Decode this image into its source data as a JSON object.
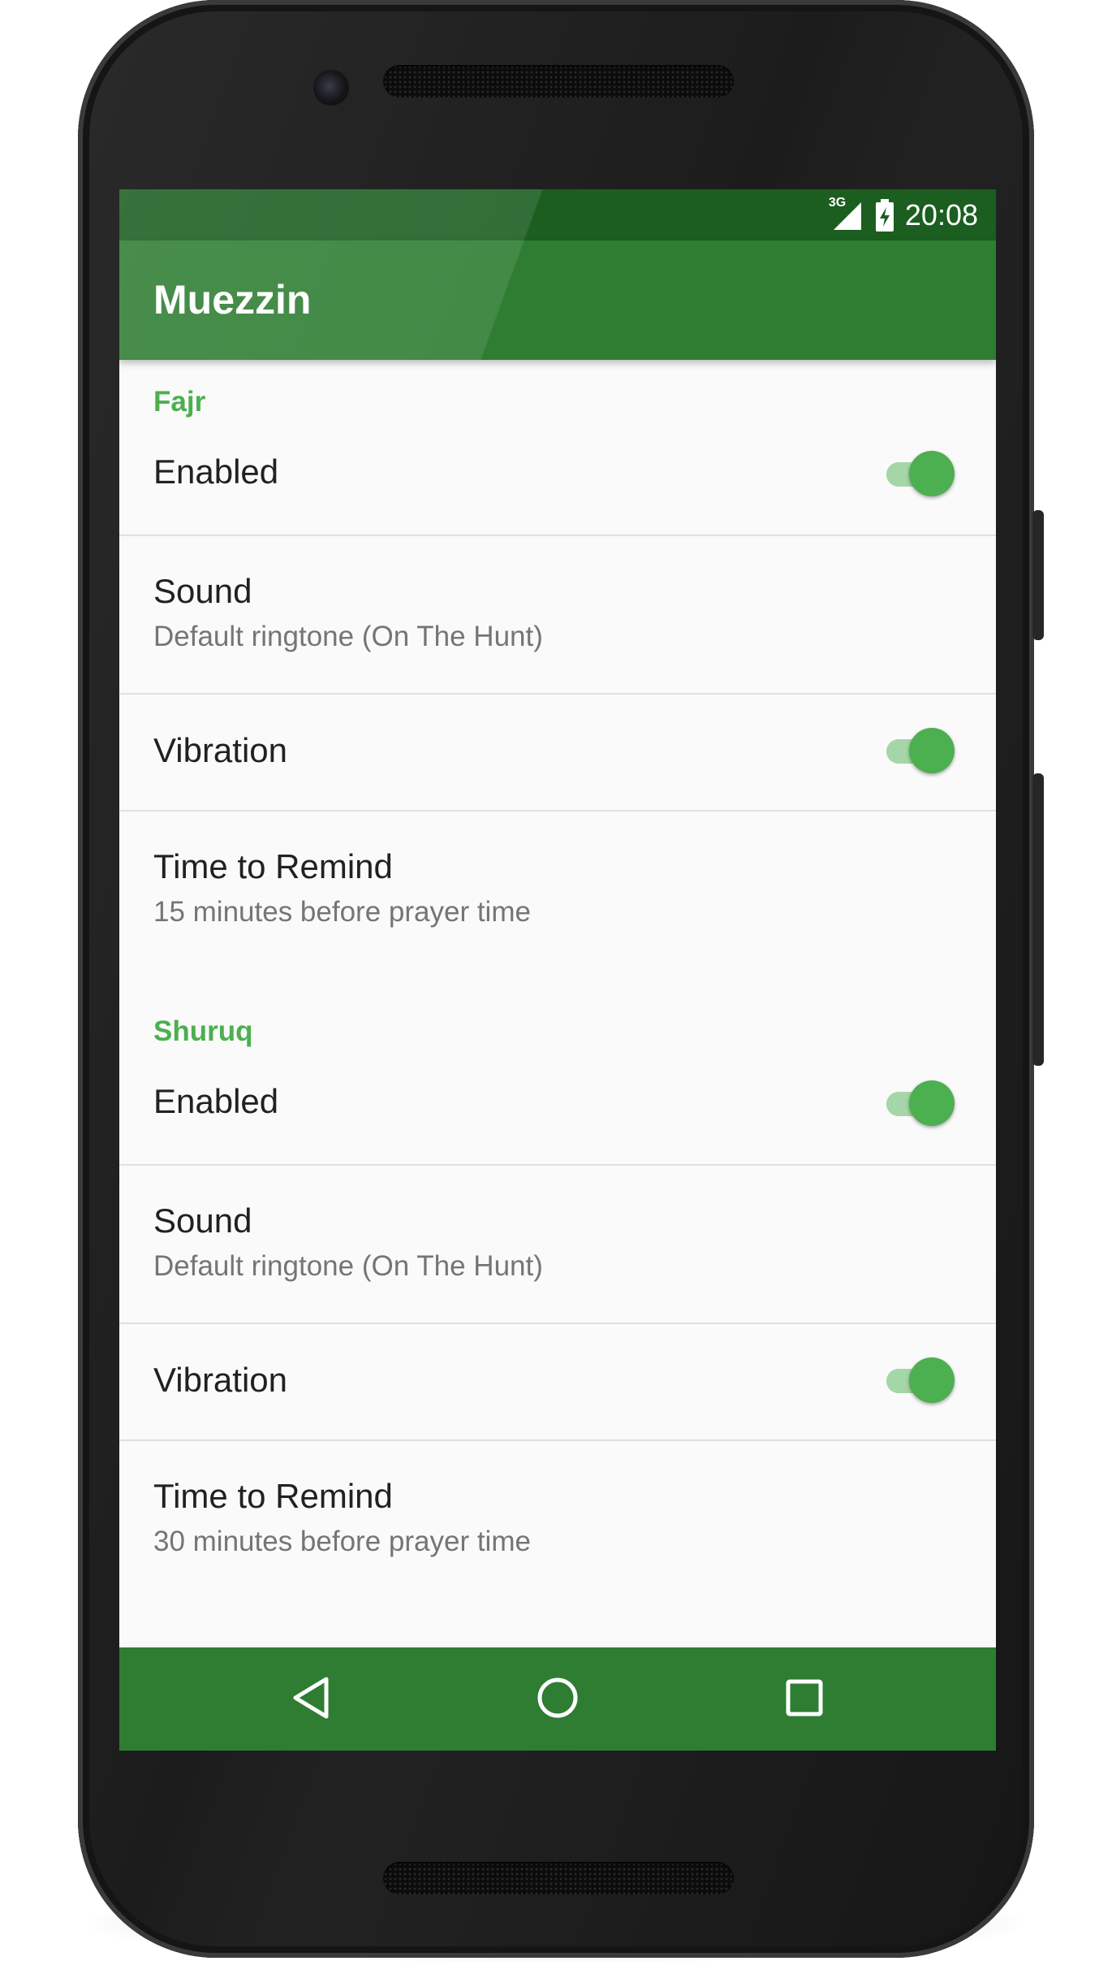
{
  "status_bar": {
    "network_label": "3G",
    "time": "20:08"
  },
  "app_bar": {
    "title": "Muezzin"
  },
  "sections": [
    {
      "category": "Fajr",
      "enabled": {
        "label": "Enabled",
        "checked": true
      },
      "sound": {
        "label": "Sound",
        "summary": "Default ringtone (On The Hunt)"
      },
      "vibration": {
        "label": "Vibration",
        "checked": true
      },
      "remind": {
        "label": "Time to Remind",
        "summary": "15 minutes before prayer time"
      }
    },
    {
      "category": "Shuruq",
      "enabled": {
        "label": "Enabled",
        "checked": true
      },
      "sound": {
        "label": "Sound",
        "summary": "Default ringtone (On The Hunt)"
      },
      "vibration": {
        "label": "Vibration",
        "checked": true
      },
      "remind": {
        "label": "Time to Remind",
        "summary": "30 minutes before prayer time"
      }
    }
  ],
  "nav_bar": {
    "back": "back-icon",
    "home": "home-icon",
    "recents": "recents-icon"
  },
  "colors": {
    "status_bar": "#1b5e20",
    "primary": "#2e7d32",
    "accent": "#4caf50",
    "switch_track": "#a5d6a7",
    "background": "#fafafa"
  }
}
